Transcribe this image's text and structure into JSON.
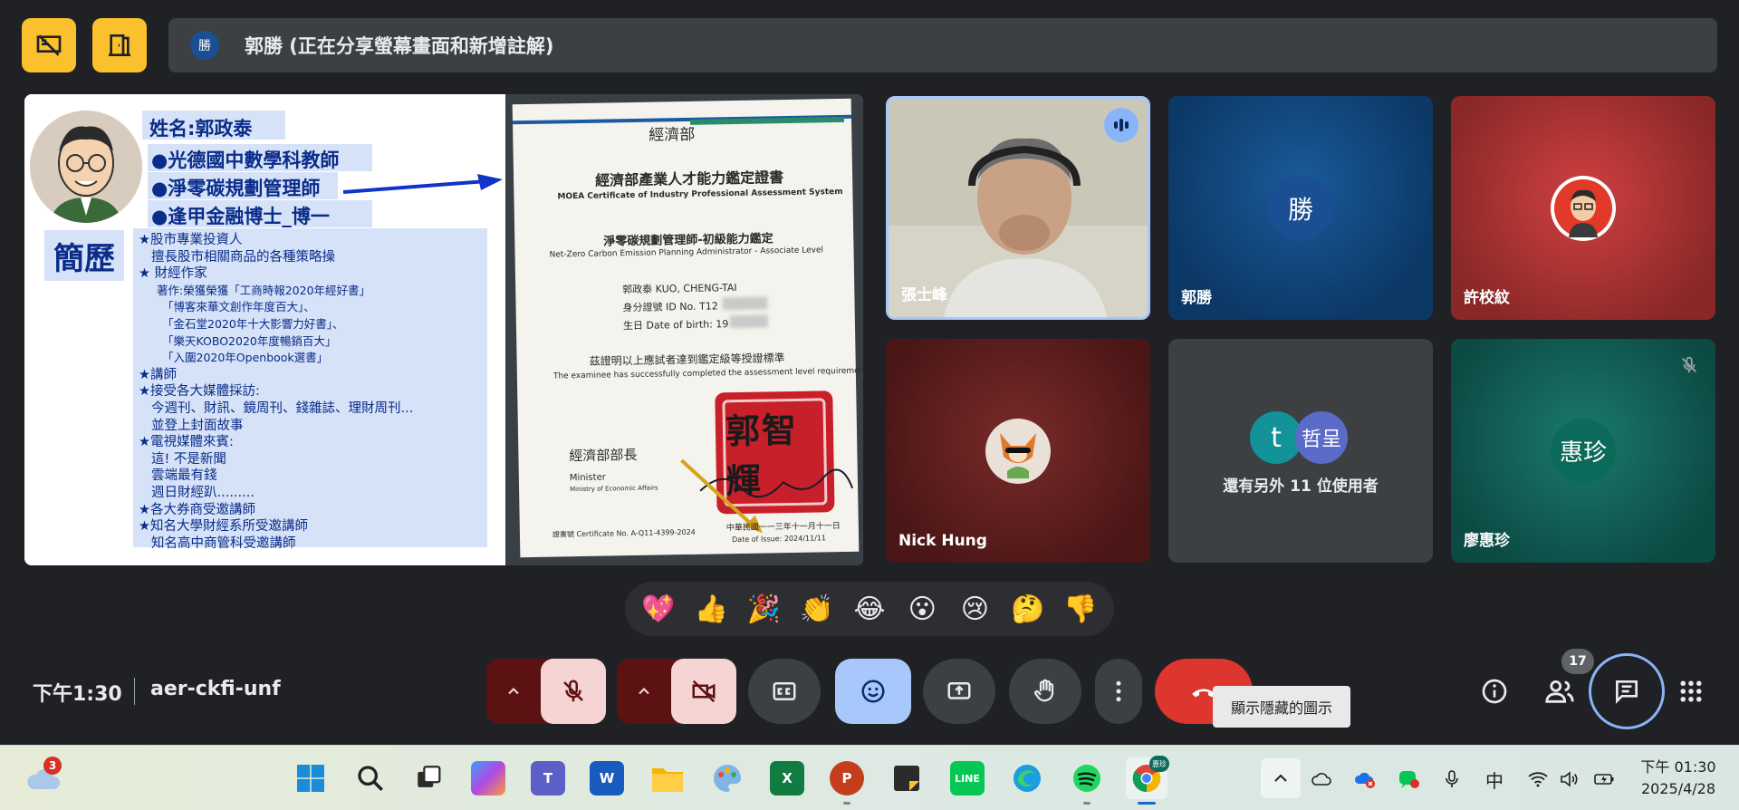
{
  "presenter": {
    "avatar_letter": "勝",
    "status": "郭勝 (正在分享螢幕畫面和新增註解)"
  },
  "slide": {
    "name_line": "姓名:郭政泰",
    "titles": [
      "●光德國中數學科教師",
      "●淨零碳規劃管理師",
      "●逢甲金融博士_博一"
    ],
    "resume_label": "簡歷",
    "resume_lines": [
      {
        "t": "★股市專業投資人",
        "lvl": 0
      },
      {
        "t": "擅長股市相關商品的各種策略操",
        "lvl": 1
      },
      {
        "t": "★ 財經作家",
        "lvl": 0
      },
      {
        "t": "著作:榮獲榮獲「工商時報2020年經好書」",
        "lvl": 2
      },
      {
        "t": "「博客來華文創作年度百大」、",
        "lvl": 3
      },
      {
        "t": "「金石堂2020年十大影響力好書」、",
        "lvl": 3
      },
      {
        "t": "「樂天KOBO2020年度暢銷百大」",
        "lvl": 3
      },
      {
        "t": "「入圍2020年Openbook選書」",
        "lvl": 3
      },
      {
        "t": "★講師",
        "lvl": 0
      },
      {
        "t": "★接受各大媒體採訪:",
        "lvl": 0
      },
      {
        "t": "今週刊、財訊、鏡周刊、錢雜誌、理財周刊...",
        "lvl": 1
      },
      {
        "t": "並登上封面故事",
        "lvl": 1
      },
      {
        "t": "★電視媒體來賓:",
        "lvl": 0
      },
      {
        "t": "這! 不是新聞",
        "lvl": 1
      },
      {
        "t": "雲端最有錢",
        "lvl": 1
      },
      {
        "t": "週日財經趴.........",
        "lvl": 1
      },
      {
        "t": "★各大券商受邀講師",
        "lvl": 0
      },
      {
        "t": "★知名大學財經系所受邀講師",
        "lvl": 0
      },
      {
        "t": "知名高中商管科受邀講師",
        "lvl": 1
      }
    ]
  },
  "certificate": {
    "ministry": "經濟部",
    "title_zh": "經濟部產業人才能力鑑定證書",
    "title_en": "MOEA Certificate of Industry Professional Assessment System",
    "course_zh": "淨零碳規劃管理師-初級能力鑑定",
    "course_en": "Net-Zero Carbon Emission Planning Administrator - Associate Level",
    "name_line": "郭政泰   KUO, CHENG-TAI",
    "id_line": "身分證號  ID No. T12",
    "dob_line": "生日   Date of birth: 19",
    "statement_zh": "茲證明以上應試者達到鑑定級等授證標準",
    "statement_en": "The examinee has successfully completed the assessment level requirements.",
    "minister_zh": "經濟部部長",
    "minister_en": "Minister",
    "ministry_en": "Ministry of Economic Affairs",
    "seal_text": "郭智輝",
    "cert_no": "證書號 Certificate No. A-Q11-4399-2024",
    "issue_zh": "中華民國一一三年十一月十一日",
    "issue_en": "Date of Issue: 2024/11/11"
  },
  "participants": [
    {
      "name": "張士峰",
      "type": "video"
    },
    {
      "name": "郭勝",
      "avatar": "勝",
      "color": "#1a4f93"
    },
    {
      "name": "許校紋",
      "type": "picture"
    },
    {
      "name": "Nick Hung",
      "type": "picture"
    },
    {
      "others_label": "還有另外 11 位使用者",
      "avatars": [
        "t",
        "哲呈"
      ]
    },
    {
      "name": "廖惠珍",
      "avatar": "惠珍",
      "color": "#0b6a5a"
    }
  ],
  "reactions": [
    "💖",
    "👍",
    "🎉",
    "👏",
    "😂",
    "😮",
    "😢",
    "🤔",
    "👎"
  ],
  "controls": {
    "time": "下午1:30",
    "meeting_code": "aer-ckfi-unf",
    "tooltip": "顯示隱藏的圖示",
    "people_count": "17"
  },
  "taskbar": {
    "weather_badge": "3",
    "line_label": "LINE",
    "lang_indicator": "中",
    "clock_time": "下午 01:30",
    "clock_date": "2025/4/28",
    "chrome_profile": "惠珍"
  },
  "colors": {
    "accent_yellow": "#fbc02d",
    "hangup_red": "#dc362e",
    "speaking_blue": "#8ab4f8"
  }
}
